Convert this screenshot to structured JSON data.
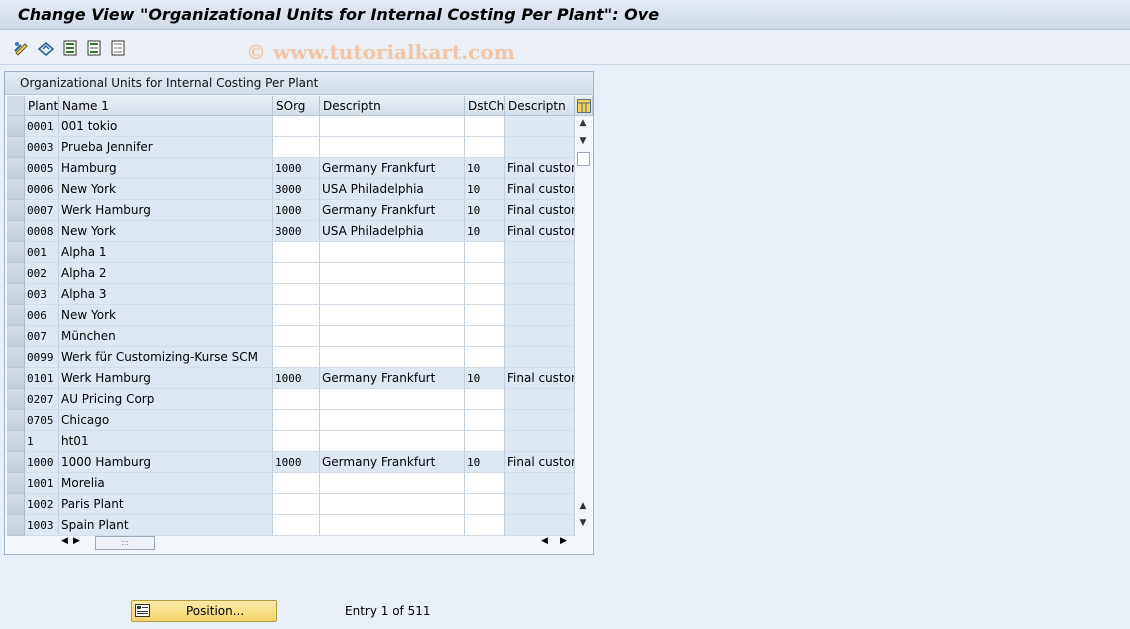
{
  "window": {
    "title": "Change View \"Organizational Units for Internal Costing Per Plant\": Ove"
  },
  "toolbar": {
    "buttons": [
      {
        "icon": "edit-icon"
      },
      {
        "icon": "other-view-icon"
      },
      {
        "icon": "select-all-icon"
      },
      {
        "icon": "select-block-icon"
      },
      {
        "icon": "deselect-all-icon"
      }
    ]
  },
  "watermark": "© www.tutorialkart.com",
  "table": {
    "title": "Organizational Units for Internal Costing Per Plant",
    "columns": [
      "Plant",
      "Name 1",
      "SOrg",
      "Descriptn",
      "DstCh",
      "Descriptn"
    ],
    "rows": [
      [
        "0001",
        "001 tokio",
        "",
        "",
        "",
        ""
      ],
      [
        "0003",
        "Prueba Jennifer",
        "",
        "",
        "",
        ""
      ],
      [
        "0005",
        "Hamburg",
        "1000",
        "Germany Frankfurt",
        "10",
        "Final custom"
      ],
      [
        "0006",
        "New York",
        "3000",
        "USA Philadelphia",
        "10",
        "Final custom"
      ],
      [
        "0007",
        "Werk Hamburg",
        "1000",
        "Germany Frankfurt",
        "10",
        "Final custom"
      ],
      [
        "0008",
        "New York",
        "3000",
        "USA Philadelphia",
        "10",
        "Final custom"
      ],
      [
        "001",
        "Alpha 1",
        "",
        "",
        "",
        ""
      ],
      [
        "002",
        "Alpha 2",
        "",
        "",
        "",
        ""
      ],
      [
        "003",
        "Alpha 3",
        "",
        "",
        "",
        ""
      ],
      [
        "006",
        "New York",
        "",
        "",
        "",
        ""
      ],
      [
        "007",
        "München",
        "",
        "",
        "",
        ""
      ],
      [
        "0099",
        "Werk für Customizing-Kurse SCM",
        "",
        "",
        "",
        ""
      ],
      [
        "0101",
        "Werk Hamburg",
        "1000",
        "Germany Frankfurt",
        "10",
        "Final custom"
      ],
      [
        "0207",
        "AU Pricing Corp",
        "",
        "",
        "",
        ""
      ],
      [
        "0705",
        "Chicago",
        "",
        "",
        "",
        ""
      ],
      [
        "1",
        "ht01",
        "",
        "",
        "",
        ""
      ],
      [
        "1000",
        "1000 Hamburg",
        "1000",
        "Germany Frankfurt",
        "10",
        "Final custom"
      ],
      [
        "1001",
        "Morelia",
        "",
        "",
        "",
        ""
      ],
      [
        "1002",
        "Paris Plant",
        "",
        "",
        "",
        ""
      ],
      [
        "1003",
        "Spain Plant",
        "",
        "",
        "",
        ""
      ]
    ]
  },
  "footer": {
    "position_label": "Position...",
    "entry_text": "Entry 1 of 511"
  }
}
